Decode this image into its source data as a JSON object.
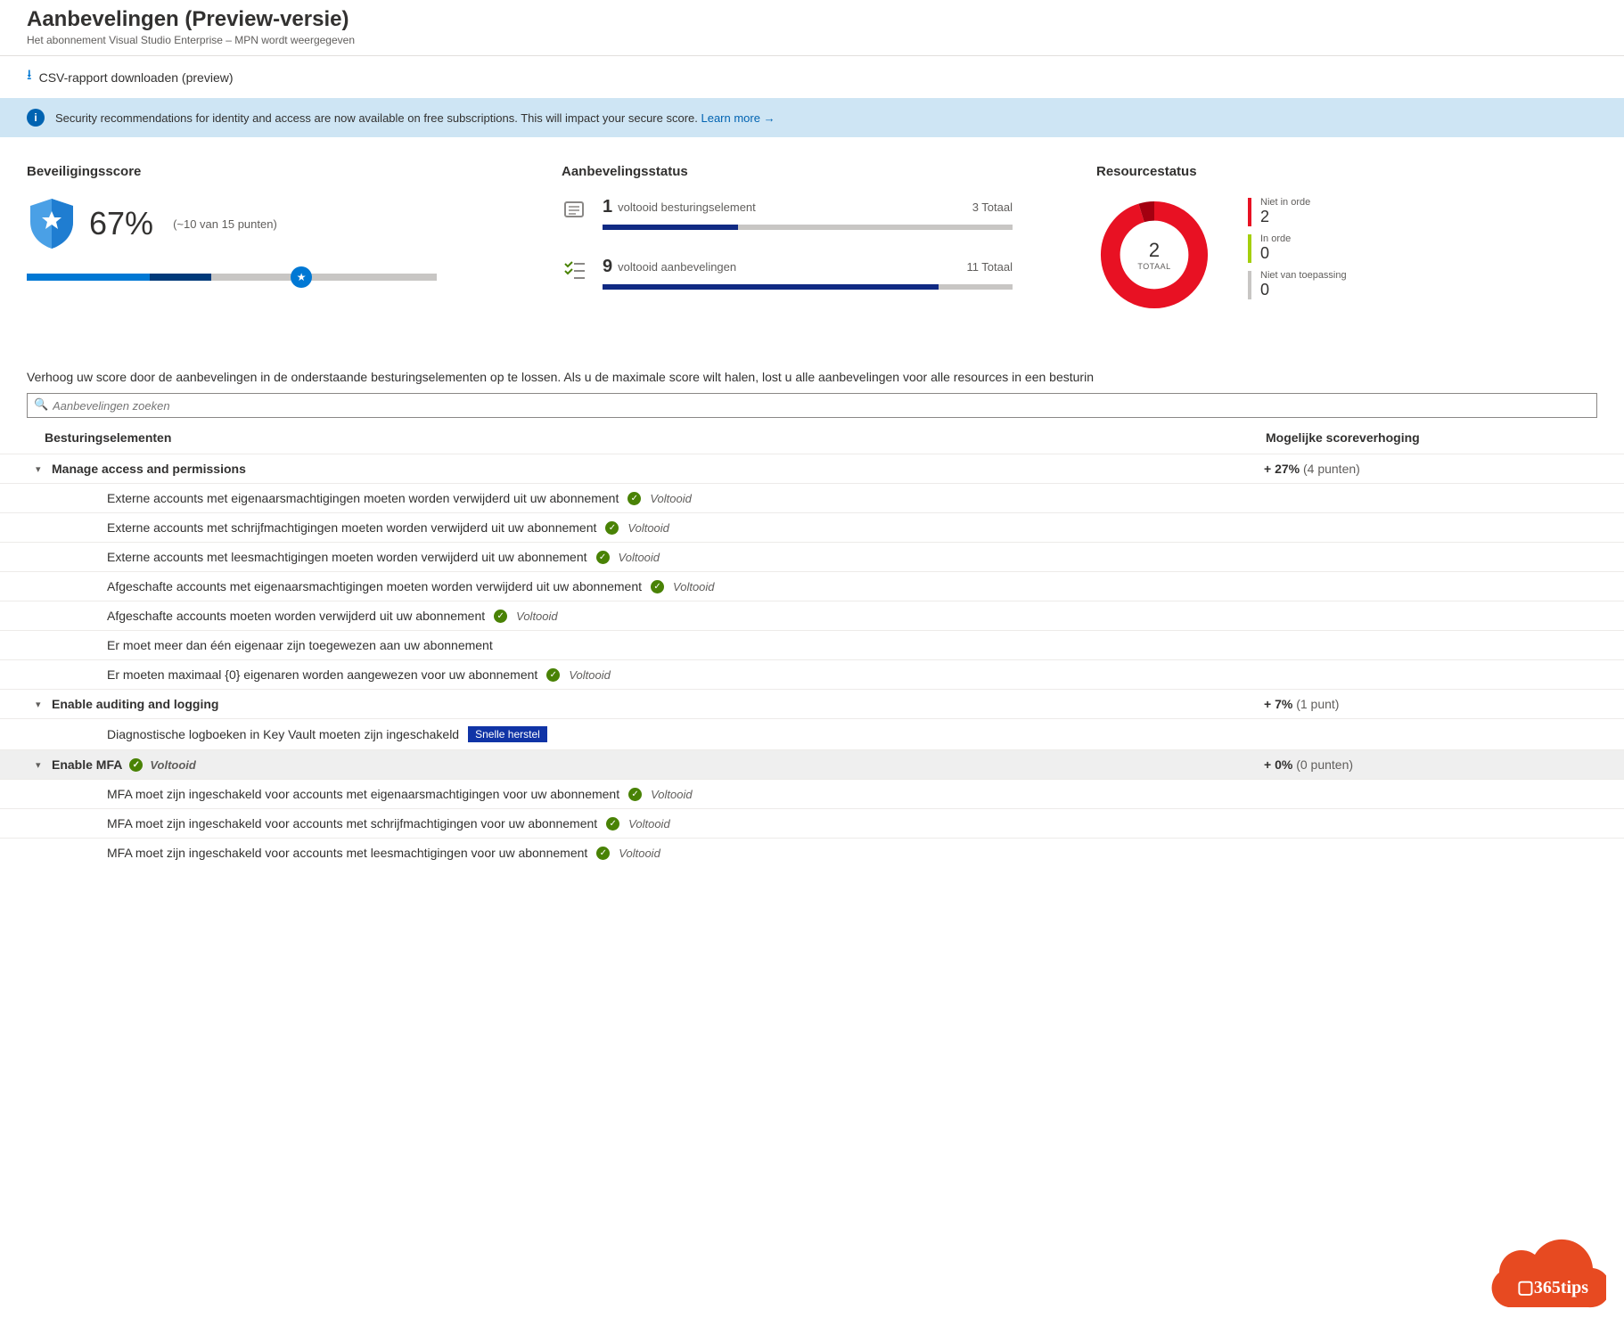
{
  "header": {
    "title": "Aanbevelingen (Preview-versie)",
    "subtitle": "Het abonnement Visual Studio Enterprise – MPN wordt weergegeven"
  },
  "toolbar": {
    "download": "CSV-rapport downloaden (preview)"
  },
  "banner": {
    "text": "Security recommendations for identity and access are now available on free subscriptions. This will impact your secure score. ",
    "learn": "Learn more →"
  },
  "score": {
    "title": "Beveiligingsscore",
    "percent": "67%",
    "sub": "(~10 van 15 punten)",
    "fill_pct_dark": 45,
    "fill_pct": 30,
    "knob_pct": 67
  },
  "status": {
    "title": "Aanbevelingsstatus",
    "rows": [
      {
        "num": "1",
        "label": "voltooid besturingselement",
        "total": "3 Totaal",
        "fill": 33
      },
      {
        "num": "9",
        "label": "voltooid aanbevelingen",
        "total": "11 Totaal",
        "fill": 82
      }
    ]
  },
  "resource": {
    "title": "Resourcestatus",
    "total_n": "2",
    "total_t": "TOTAAL",
    "legend": [
      {
        "label": "Niet in orde",
        "value": "2",
        "color": "#e81123"
      },
      {
        "label": "In orde",
        "value": "0",
        "color": "#a4cf0c"
      },
      {
        "label": "Niet van toepassing",
        "value": "0",
        "color": "#c8c6c4"
      }
    ]
  },
  "main": {
    "desc": "Verhoog uw score door de aanbevelingen in de onderstaande besturingselementen op te lossen. Als u de maximale score wilt halen, lost u alle aanbevelingen voor alle resources in een besturin",
    "search_ph": "Aanbevelingen zoeken",
    "col1": "Besturingselementen",
    "col2": "Mogelijke scoreverhoging",
    "completed_label": "Voltooid",
    "quickfix": "Snelle herstel",
    "controls": [
      {
        "name": "Manage access and permissions",
        "score_b": "+ 27%",
        "score_s": "(4 punten)",
        "completed": false,
        "recs": [
          {
            "t": "Externe accounts met eigenaarsmachtigingen moeten worden verwijderd uit uw abonnement",
            "c": true
          },
          {
            "t": "Externe accounts met schrijfmachtigingen moeten worden verwijderd uit uw abonnement",
            "c": true
          },
          {
            "t": "Externe accounts met leesmachtigingen moeten worden verwijderd uit uw abonnement",
            "c": true
          },
          {
            "t": "Afgeschafte accounts met eigenaarsmachtigingen moeten worden verwijderd uit uw abonnement",
            "c": true
          },
          {
            "t": "Afgeschafte accounts moeten worden verwijderd uit uw abonnement",
            "c": true
          },
          {
            "t": "Er moet meer dan één eigenaar zijn toegewezen aan uw abonnement",
            "c": false
          },
          {
            "t": "Er moeten maximaal {0} eigenaren worden aangewezen voor uw abonnement",
            "c": true
          }
        ]
      },
      {
        "name": "Enable auditing and logging",
        "score_b": "+ 7%",
        "score_s": "(1 punt)",
        "completed": false,
        "recs": [
          {
            "t": "Diagnostische logboeken in Key Vault moeten zijn ingeschakeld",
            "c": false,
            "qf": true
          }
        ]
      },
      {
        "name": "Enable MFA",
        "score_b": "+ 0%",
        "score_s": "(0 punten)",
        "completed": true,
        "selected": true,
        "recs": [
          {
            "t": "MFA moet zijn ingeschakeld voor accounts met eigenaarsmachtigingen voor uw abonnement",
            "c": true
          },
          {
            "t": "MFA moet zijn ingeschakeld voor accounts met schrijfmachtigingen voor uw abonnement",
            "c": true
          },
          {
            "t": "MFA moet zijn ingeschakeld voor accounts met leesmachtigingen voor uw abonnement",
            "c": true
          }
        ]
      }
    ]
  },
  "watermark": "365tips"
}
